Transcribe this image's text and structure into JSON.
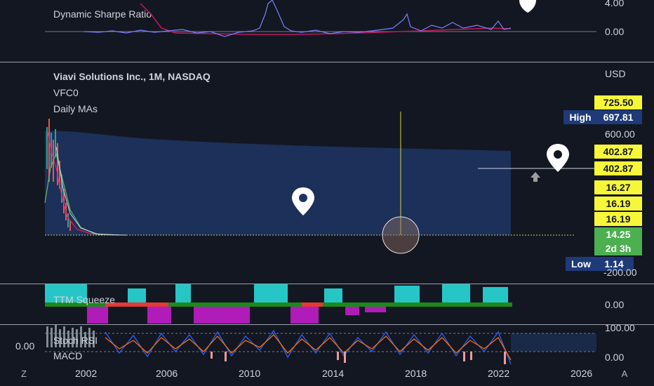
{
  "panes": {
    "sharpe": {
      "legend": "Dynamic Sharpe Ratio",
      "axis_labels": [
        "4.00",
        "0.00"
      ]
    },
    "main": {
      "title": "Viavi Solutions Inc., 1M, NASDAQ",
      "indicator1": "VFC0",
      "indicator2": "Daily MAs",
      "currency": "USD",
      "axis_labels": [
        "600.00",
        "-200.00"
      ],
      "tags": {
        "high_top": "725.50",
        "high_label": "High",
        "high_value": "697.81",
        "level1": "402.87",
        "level2": "402.87",
        "p1": "16.27",
        "p2": "16.19",
        "p3": "16.19",
        "current": "14.25",
        "countdown": "2d 3h",
        "low_label": "Low",
        "low_value": "1.14"
      }
    },
    "ttm": {
      "legend": "TTM Squeeze",
      "axis_labels": [
        "0.00"
      ]
    },
    "stoch": {
      "legend1": "Stoch RSI",
      "legend2": "MACD",
      "left_value": "0.00",
      "axis_labels": [
        "100.00",
        "0.00"
      ]
    }
  },
  "time_axis": [
    "2002",
    "2006",
    "2010",
    "2014",
    "2018",
    "2022",
    "2026"
  ],
  "buttons": {
    "left": "Z",
    "right": "A"
  },
  "colors": {
    "background": "#131722",
    "band": "#1e3563",
    "sharpe_line": "#7b7fff",
    "sharpe_ma": "#c2185b",
    "squeeze_pos": "#26c6c6",
    "squeeze_neg": "#b01cb8",
    "stoch_k": "#2962ff",
    "stoch_d": "#ff6d00"
  }
}
